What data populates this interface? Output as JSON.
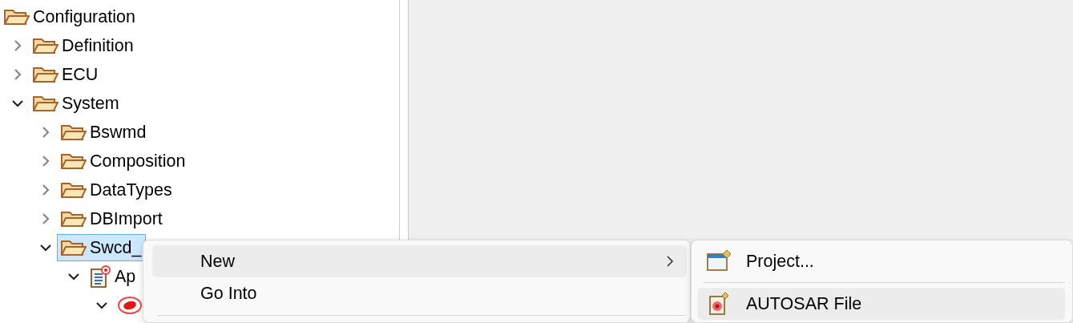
{
  "tree": [
    {
      "label": "Configuration",
      "kind": "folder",
      "selected": false,
      "children": [
        {
          "label": "Definition",
          "kind": "folder",
          "expanded": false,
          "selected": false
        },
        {
          "label": "ECU",
          "kind": "folder",
          "expanded": false,
          "selected": false
        },
        {
          "label": "System",
          "kind": "folder",
          "expanded": true,
          "selected": false,
          "children": [
            {
              "label": "Bswmd",
              "kind": "folder",
              "expanded": false,
              "selected": false
            },
            {
              "label": "Composition",
              "kind": "folder",
              "expanded": false,
              "selected": false
            },
            {
              "label": "DataTypes",
              "kind": "folder",
              "expanded": false,
              "selected": false
            },
            {
              "label": "DBImport",
              "kind": "folder",
              "expanded": false,
              "selected": false
            },
            {
              "label": "Swcd_",
              "kind": "folder",
              "expanded": true,
              "selected": true,
              "children": [
                {
                  "label": "Ap",
                  "kind": "file",
                  "expanded": true,
                  "selected": false,
                  "children": [
                    {
                      "kind": "component",
                      "expanded": true,
                      "selected": false
                    }
                  ]
                }
              ]
            }
          ]
        }
      ]
    }
  ],
  "context_menu": [
    {
      "kind": "item",
      "label": "New",
      "selected": true,
      "has_submenu": true
    },
    {
      "kind": "item",
      "label": "Go Into",
      "selected": false,
      "has_submenu": false
    },
    {
      "kind": "separator"
    }
  ],
  "submenu": [
    {
      "kind": "project",
      "label": "Project...",
      "selected": false
    },
    {
      "kind": "separator"
    },
    {
      "kind": "autosar-file",
      "label": "AUTOSAR File",
      "selected": true
    }
  ]
}
